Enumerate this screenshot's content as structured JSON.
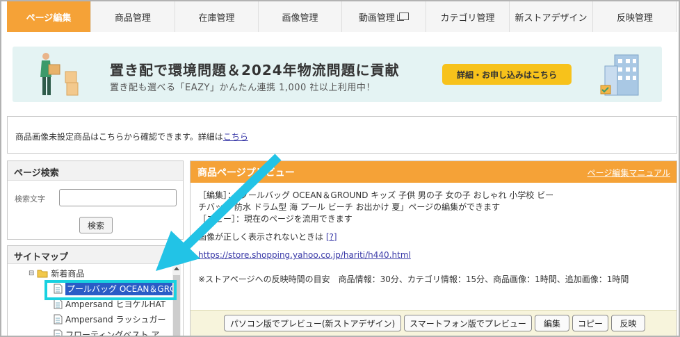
{
  "tabs": [
    {
      "label": "ページ編集",
      "active": true
    },
    {
      "label": "商品管理"
    },
    {
      "label": "在庫管理"
    },
    {
      "label": "画像管理"
    },
    {
      "label": "動画管理"
    },
    {
      "label": "カテゴリ管理"
    },
    {
      "label": "新ストアデザイン"
    },
    {
      "label": "反映管理"
    }
  ],
  "banner": {
    "title": "置き配で環境問題＆2024年物流問題に貢献",
    "subtitle": "置き配も選べる「EAZY」かんたん連携 1,000 社以上利用中！",
    "cta": "詳細・お申し込みはこちら"
  },
  "notice": {
    "text": "商品画像未設定商品はこちらから確認できます。詳細は",
    "link": "こちら"
  },
  "page_search": {
    "title": "ページ検索",
    "label": "検索文字",
    "input_value": "",
    "button": "検索"
  },
  "sitemap": {
    "title": "サイトマップ",
    "items": [
      {
        "label": "新着商品"
      },
      {
        "label": "プールバッグ OCEAN＆GROUND キッズ"
      },
      {
        "label": "Ampersand ヒヨケルHAT"
      },
      {
        "label": "Ampersand ラッシュガー"
      },
      {
        "label": "フローティングベスト ア"
      }
    ]
  },
  "preview": {
    "title": "商品ページプレビュー",
    "manual_link": "ページ編集マニュアル",
    "line1": "［編集］：「プールバッグ OCEAN＆GROUND キッズ 子供 男の子 女の子 おしゃれ 小学校 ビー",
    "line2": "チバッグ 防水 ドラム型 海 プール ビーチ お出かけ 夏」ページの編集ができます",
    "line3": "［コピー］：現在のページを流用できます",
    "image_notice": "画像が正しく表示されないときは",
    "image_help": "[?]",
    "url": "https://store.shopping.yahoo.co.jp/hariti/h440.html",
    "timing": "※ストアページへの反映時間の目安　商品情報：30分、カテゴリ情報：15分、商品画像：1時間、追加画像：1時間",
    "buttons": {
      "pc_preview": "パソコン版でプレビュー(新ストアデザイン)",
      "sp_preview": "スマートフォン版でプレビュー",
      "edit": "編集",
      "copy": "コピー",
      "reflect": "反映"
    }
  },
  "colors": {
    "accent": "#f5a237",
    "highlight": "#19d1e0",
    "arrow": "#22c3e6",
    "selected": "#2a5cc6"
  }
}
